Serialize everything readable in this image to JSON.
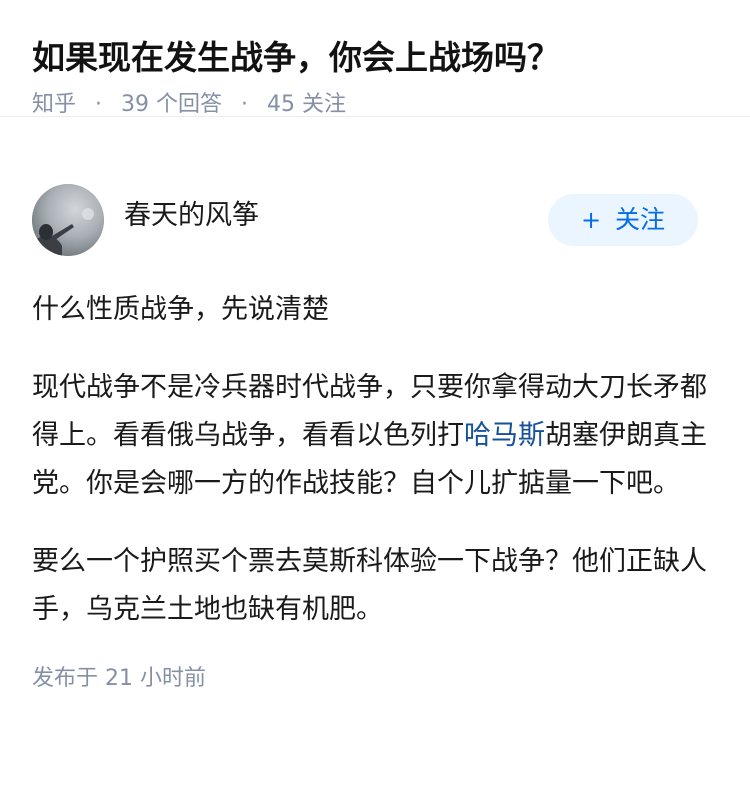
{
  "question": {
    "title": "如果现在发生战争，你会上战场吗？",
    "source": "知乎",
    "answer_count": "39 个回答",
    "follower_count": "45 关注"
  },
  "answer": {
    "author": {
      "name": "春天的风筝",
      "avatar_icon": "avatar-photo-icon"
    },
    "follow_button": {
      "icon": "plus-icon",
      "plus": "+",
      "label": "关注"
    },
    "paragraphs": [
      {
        "text": "什么性质战争，先说清楚"
      },
      {
        "before_link": "现代战争不是冷兵器时代战争，只要你拿得动大刀长矛都得上。看看俄乌战争，看看以色列打",
        "link_text": "哈马斯",
        "after_link": "胡塞伊朗真主党。你是会哪一方的作战技能？自个儿扩掂量一下吧。"
      },
      {
        "text": "要么一个护照买个票去莫斯科体验一下战争？他们正缺人手，乌克兰土地也缺有机肥。"
      }
    ],
    "published": "发布于 21 小时前"
  },
  "colors": {
    "link": "#175199",
    "accent": "#056de8",
    "meta": "#8590a6",
    "follow_bg": "#ebf5ff"
  }
}
